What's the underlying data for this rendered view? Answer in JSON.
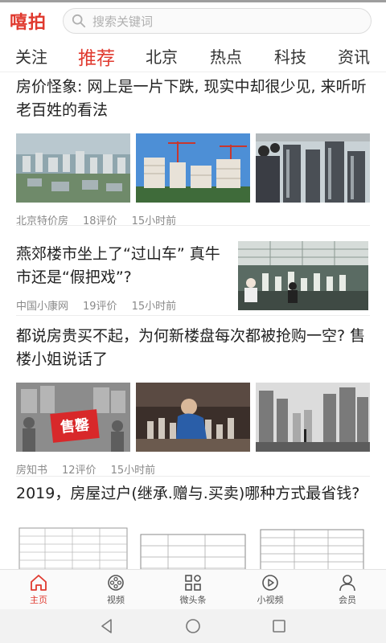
{
  "app": {
    "logo": "嘻拍"
  },
  "search": {
    "placeholder": "搜索关键词"
  },
  "tabs": [
    {
      "label": "关注",
      "active": false
    },
    {
      "label": "推荐",
      "active": true
    },
    {
      "label": "北京",
      "active": false
    },
    {
      "label": "热点",
      "active": false
    },
    {
      "label": "科技",
      "active": false
    },
    {
      "label": "资讯",
      "active": false
    }
  ],
  "articles": [
    {
      "title": "房价怪象: 网上是一片下跌, 现实中却很少见, 来听听老百姓的看法",
      "source": "北京特价房",
      "comments": "18评价",
      "time": "15小时前",
      "images": [
        "aerial-city-photo",
        "apartment-towers-photo",
        "crowd-towers-photo"
      ]
    },
    {
      "title": "燕郊楼市坐上了“过山车” 真牛市还是“假把戏”?",
      "source": "中国小康网",
      "comments": "19评价",
      "time": "15小时前",
      "images": [
        "sales-model-photo"
      ]
    },
    {
      "title": "都说房贵买不起，为何新楼盘每次都被抢购一空? 售楼小姐说话了",
      "source": "房知书",
      "comments": "12评价",
      "time": "15小时前",
      "sign_text": "售罄",
      "images": [
        "sold-out-sign-photo",
        "model-viewer-photo",
        "street-towers-photo"
      ]
    },
    {
      "title": "2019，房屋过户(继承.赠与.买卖)哪种方式最省钱?",
      "images": [
        "document-table-1",
        "document-table-2",
        "document-table-3"
      ]
    }
  ],
  "bottom_nav": [
    {
      "label": "主页",
      "icon": "home-icon",
      "active": true
    },
    {
      "label": "视频",
      "icon": "film-reel-icon",
      "active": false
    },
    {
      "label": "微头条",
      "icon": "grid-icon",
      "active": false
    },
    {
      "label": "小视频",
      "icon": "play-circle-icon",
      "active": false
    },
    {
      "label": "会员",
      "icon": "user-icon",
      "active": false
    }
  ],
  "colors": {
    "accent": "#e03a2f",
    "text": "#222222",
    "meta": "#8a8a8a"
  }
}
